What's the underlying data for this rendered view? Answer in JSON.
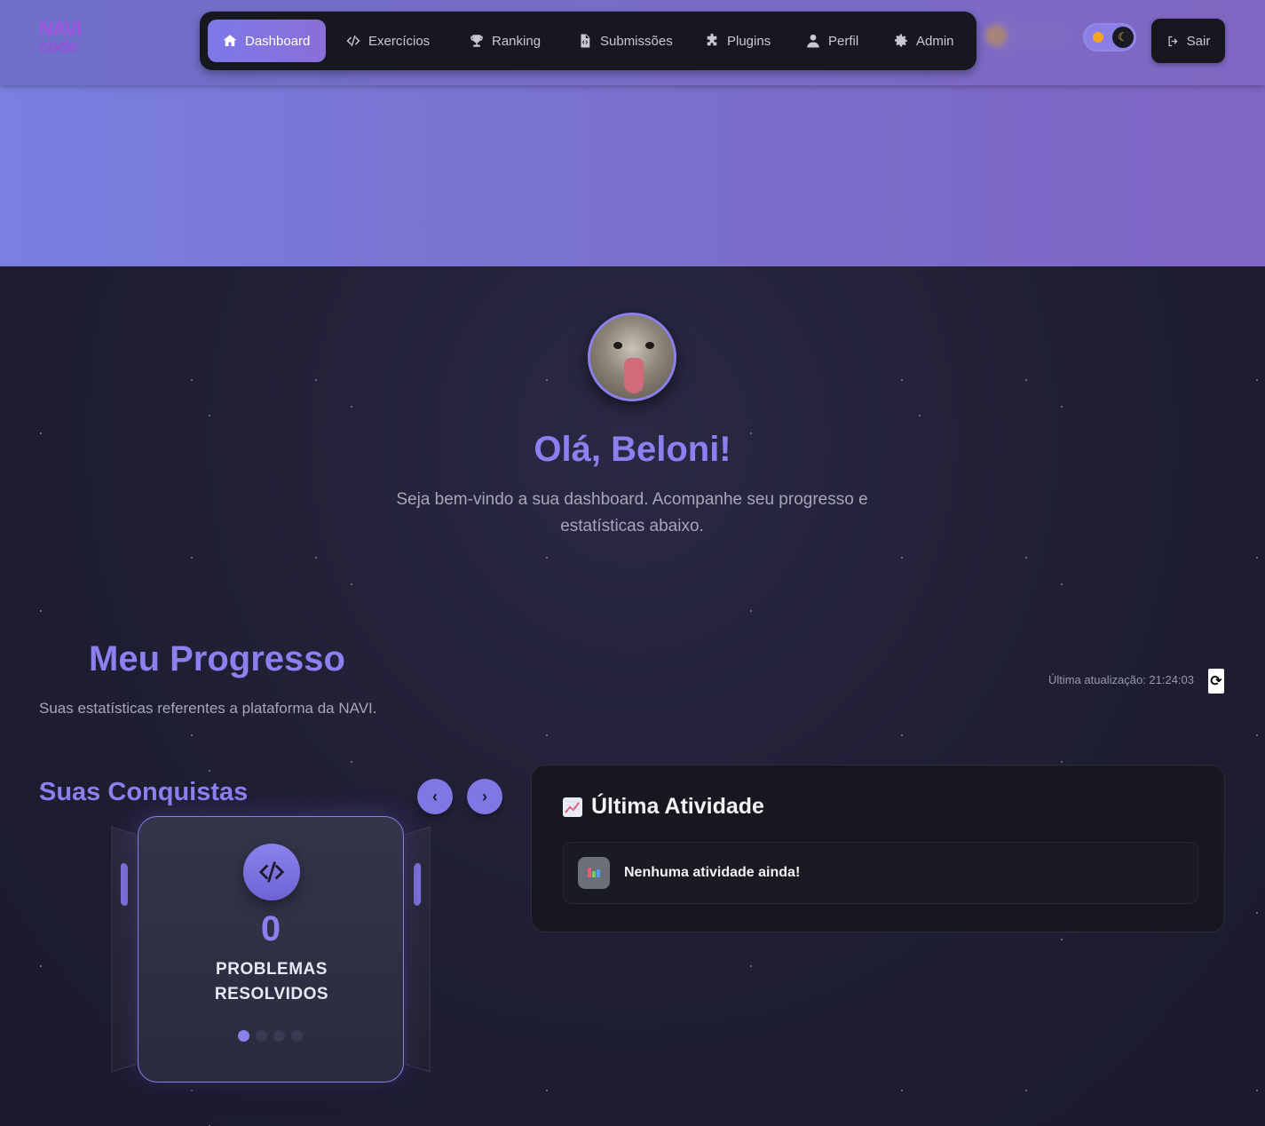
{
  "header": {
    "logo": {
      "line1": "NAVI",
      "line2": "code"
    },
    "nav": [
      {
        "label": "Dashboard",
        "icon": "home-icon",
        "active": true
      },
      {
        "label": "Exercícios",
        "icon": "code-icon",
        "active": false
      },
      {
        "label": "Ranking",
        "icon": "trophy-icon",
        "active": false
      },
      {
        "label": "Submissões",
        "icon": "file-code-icon",
        "active": false
      },
      {
        "label": "Plugins",
        "icon": "puzzle-icon",
        "active": false
      },
      {
        "label": "Perfil",
        "icon": "user-icon",
        "active": false
      },
      {
        "label": "Admin",
        "icon": "gear-icon",
        "active": false
      }
    ],
    "logout_label": "Sair"
  },
  "hero": {
    "greeting": "Olá, Beloni!",
    "welcome": "Seja bem-vindo a sua dashboard. Acompanhe seu progresso e estatísticas abaixo."
  },
  "progress": {
    "title": "Meu Progresso",
    "subtitle": "Suas estatísticas referentes a plataforma da NAVI.",
    "last_update": "Última atualização: 21:24:03"
  },
  "achievements": {
    "title": "Suas Conquistas",
    "current": {
      "value": "0",
      "label": "PROBLEMAS RESOLVIDOS"
    },
    "dot_count": 4,
    "active_dot": 0
  },
  "activity": {
    "title": "Última Atividade",
    "empty_text": "Nenhuma atividade ainda!"
  },
  "colors": {
    "accent": "#8c7ff0",
    "nav_bg": "#17181f",
    "page_bg": "#1f1e33"
  }
}
